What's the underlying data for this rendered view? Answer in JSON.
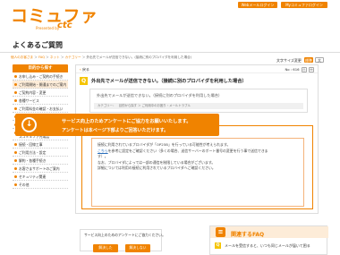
{
  "header": {
    "logo_main": "コミュファ",
    "logo_sub": "Presented by",
    "logo_ctc": "ctc",
    "btn_web": "Webメールログイン",
    "btn_my": "Myコミュファログイン"
  },
  "page": {
    "title": "よくあるご質問",
    "breadcrumb": [
      "個人のお客さま",
      "FAQ",
      "ネット",
      "カテゴリー",
      "外出先でメールが送信できない。(接続に別のプロバイダを利用した場合)"
    ],
    "fontsize_label": "文字サイズ変更",
    "fontsize_options": [
      "標準",
      "大"
    ]
  },
  "sidebar": {
    "heading": "目的から探す",
    "items": [
      {
        "label": "お申し込み・ご契約の手続き"
      },
      {
        "label": "ご利用開始・開通までのご案内",
        "active": true
      },
      {
        "label": "ご契約内容・変更"
      },
      {
        "label": "各種サービス"
      },
      {
        "label": "ご利用料金の確認・お支払い"
      },
      {
        "label": "故障・障害・不具合"
      },
      {
        "label": "設定・困った時の対処法"
      },
      {
        "label": "光ケーブル・オプションサービスコミュファ光電話",
        "tall": true
      },
      {
        "label": "接続・回線工事"
      },
      {
        "label": "ご利用方法・設定"
      },
      {
        "label": "解約・各種手続き"
      },
      {
        "label": "お客さまサポートのご案内"
      },
      {
        "label": "セキュリティ関連"
      },
      {
        "label": "その他"
      }
    ]
  },
  "main": {
    "back_label": "戻る",
    "faq_no": "No : 616",
    "print_label": "印刷",
    "question": {
      "marker": "Q",
      "title": "外出先でメールが送信できない。（接続に別のプロバイダを利用した場合）",
      "body": "外出先でメールが送信できない。（接続に別のプロバイダを利用した場合）",
      "category": "カテゴリー：　目的から探す ＞ ご利用中のお困り・メールトラブル"
    },
    "answer": {
      "marker": "A",
      "line1": "接続に利用されているプロバイダが「OP25B」を行っている可能性が考えられます。",
      "link": "こちら",
      "line2": "を参考に設定をご確認ください（多くの場合、送信サーバーのポート番号の変更を行う事で送信できま",
      "line3": "す）。",
      "line4": "なお、プロバイダによっては一部の通信を制限している場合がございます。",
      "line5": "詳細については利用の接続に利用されているプロバイダへご確認ください。"
    }
  },
  "survey": {
    "line1": "サービス向上のためアンケートにご協力をお願いいたします。",
    "line2": "アンケートは本ページ下部よりご回答いただけます。"
  },
  "feedback": {
    "prompt": "サービス向上のためのアンケートにご協力ください。",
    "btn_yes": "解決した",
    "btn_no": "解決しない"
  },
  "related": {
    "title": "関連するFAQ",
    "item": "メールを受信すると、いつも同じメールが届いて困る"
  }
}
